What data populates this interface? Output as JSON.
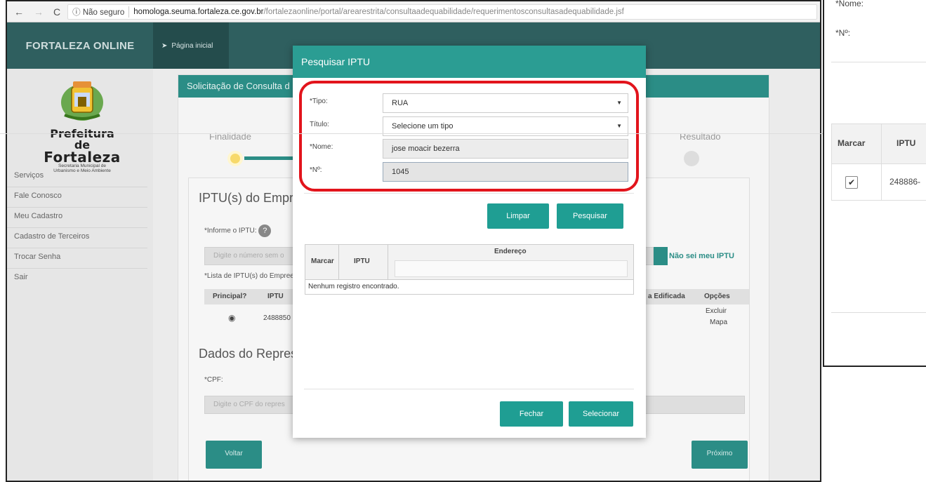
{
  "browser": {
    "back": "←",
    "forward": "→",
    "reload": "C",
    "security": "ⓘ Não seguro",
    "host": "homologa.seuma.fortaleza.ce.gov.br",
    "path": "/fortalezaonline/portal/arearestrita/consultaadequabilidade/requerimentosconsultasadequabilidade.jsf"
  },
  "header": {
    "brand": "FORTALEZA ONLINE",
    "home_label": "Página inicial"
  },
  "logo": {
    "line1": "Prefeitura de",
    "line2": "Fortaleza",
    "line3": "Secretaria Municipal de",
    "line4": "Urbanismo e Meio Ambiente"
  },
  "sidebar": {
    "items": [
      "Serviços",
      "Fale Conosco",
      "Meu Cadastro",
      "Cadastro de Terceiros",
      "Trocar Senha",
      "Sair"
    ]
  },
  "panel": {
    "title": "Solicitação de Consulta d",
    "step_first": "Finalidade",
    "step_last": "Resultado",
    "section1_title": "IPTU(s) do Empre",
    "informe_label": "*Informe o IPTU:",
    "iptu_placeholder": "Digite o número sem o",
    "nao_sei": "Não sei meu IPTU",
    "lista_label": "*Lista de IPTU(s) do Empree",
    "table_headers": [
      "Principal?",
      "IPTU",
      "a Edificada",
      "Opções"
    ],
    "row_iptu": "2488850",
    "row_options": [
      "Excluir",
      "Mapa"
    ],
    "section2_title": "Dados do Repres",
    "cpf_label": "*CPF:",
    "cpf_placeholder": "Digite o CPF do repres",
    "voltar": "Voltar",
    "proximo": "Próximo"
  },
  "modal": {
    "title": "Pesquisar IPTU",
    "tipo_label": "*Tipo:",
    "tipo_value": "RUA",
    "titulo_label": "Título:",
    "titulo_value": "Selecione um tipo",
    "nome_label": "*Nome:",
    "nome_value": "jose moacir bezerra",
    "numero_label": "*Nº:",
    "numero_value": "1045",
    "limpar": "Limpar",
    "pesquisar": "Pesquisar",
    "col_marcar": "Marcar",
    "col_iptu": "IPTU",
    "col_endereco": "Endereço",
    "empty_message": "Nenhum registro encontrado.",
    "fechar": "Fechar",
    "selecionar": "Selecionar"
  },
  "zoom": {
    "nome_label": "*Nome:",
    "numero_label": "*Nº:",
    "col_marcar": "Marcar",
    "col_iptu": "IPTU",
    "row_iptu": "248886-",
    "checked": true
  },
  "colors": {
    "accent": "#2b9d93",
    "header_bg": "#2f5f5f",
    "highlight": "#e2141c"
  }
}
